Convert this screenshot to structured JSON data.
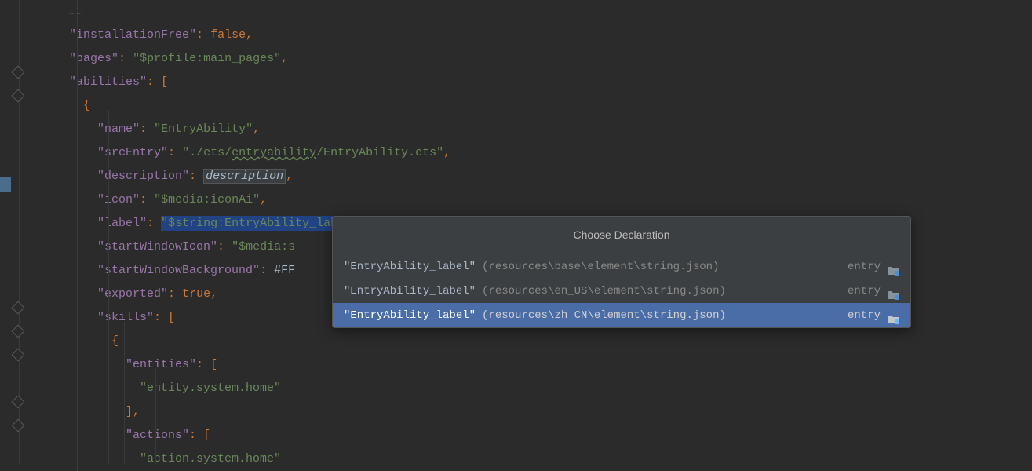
{
  "code": {
    "line0_partial": "……",
    "installationFree_key": "\"installationFree\"",
    "installationFree_val": "false",
    "pages_key": "\"pages\"",
    "pages_val": "\"$profile:main_pages\"",
    "abilities_key": "\"abilities\"",
    "name_key": "\"name\"",
    "name_val": "\"EntryAbility\"",
    "srcEntry_key": "\"srcEntry\"",
    "srcEntry_val_pre": "\"./ets/",
    "srcEntry_val_underlined": "entryability",
    "srcEntry_val_post": "/EntryAbility.ets\"",
    "description_key": "\"description\"",
    "description_val": "description",
    "icon_key": "\"icon\"",
    "icon_val": "\"$media:iconAi\"",
    "label_key": "\"label\"",
    "label_val": "\"$string:EntryAbility_label\"",
    "startWindowIcon_key": "\"startWindowIcon\"",
    "startWindowIcon_val": "\"$media:s",
    "startWindowBackground_key": "\"startWindowBackground\"",
    "startWindowBackground_val": "#FF",
    "exported_key": "\"exported\"",
    "exported_val": "true",
    "skills_key": "\"skills\"",
    "entities_key": "\"entities\"",
    "entities_val": "\"entity.system.home\"",
    "actions_key": "\"actions\"",
    "actions_val": "\"action.system.home\""
  },
  "popup": {
    "title": "Choose Declaration",
    "items": [
      {
        "name": "\"EntryAbility_label\"",
        "path": "(resources\\base\\element\\string.json)",
        "module": "entry"
      },
      {
        "name": "\"EntryAbility_label\"",
        "path": "(resources\\en_US\\element\\string.json)",
        "module": "entry"
      },
      {
        "name": "\"EntryAbility_label\"",
        "path": "(resources\\zh_CN\\element\\string.json)",
        "module": "entry"
      }
    ]
  }
}
